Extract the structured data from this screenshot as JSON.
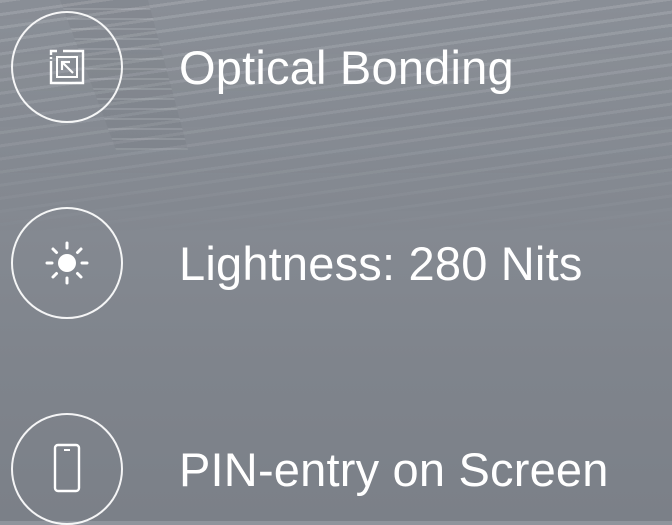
{
  "features": [
    {
      "icon": "optical-bonding-icon",
      "label": "Optical Bonding"
    },
    {
      "icon": "brightness-sun-icon",
      "label": "Lightness: 280 Nits"
    },
    {
      "icon": "smartphone-icon",
      "label": "PIN-entry on Screen"
    }
  ],
  "colors": {
    "text": "#ffffff",
    "background": "#868b93"
  }
}
